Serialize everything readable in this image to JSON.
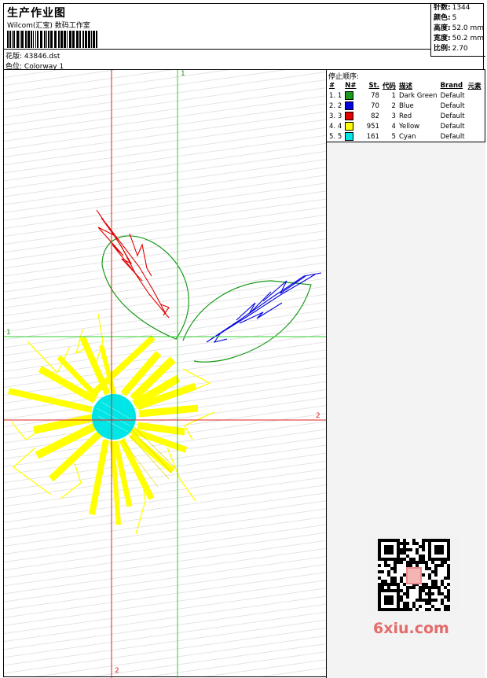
{
  "header": {
    "title": "生产作业图",
    "company": "Wilcom(汇宝) 数码工作室",
    "design_label": "花版:",
    "design_file": "43846.dst",
    "colorway_label": "色位:",
    "colorway": "Colorway 1"
  },
  "stats": {
    "stitches_label": "针数:",
    "stitches": "1344",
    "colors_label": "颜色:",
    "colors": "5",
    "height_label": "高度:",
    "height": "52.0 mm",
    "width_label": "宽度:",
    "width": "50.2 mm",
    "scale_label": "比例:",
    "scale": "2.70"
  },
  "legend": {
    "title": "停止顺序:",
    "columns": [
      "#",
      "N#",
      "St.",
      "代码",
      "描述",
      "Brand",
      "元素"
    ],
    "rows": [
      {
        "idx": "1.",
        "n": "1",
        "color": "#1a9a1a",
        "st": "78",
        "code": "1",
        "desc": "Dark Green",
        "brand": "Default"
      },
      {
        "idx": "2.",
        "n": "2",
        "color": "#0000e0",
        "st": "70",
        "code": "2",
        "desc": "Blue",
        "brand": "Default"
      },
      {
        "idx": "3.",
        "n": "3",
        "color": "#e00000",
        "st": "82",
        "code": "3",
        "desc": "Red",
        "brand": "Default"
      },
      {
        "idx": "4.",
        "n": "4",
        "color": "#ffff00",
        "st": "951",
        "code": "4",
        "desc": "Yellow",
        "brand": "Default"
      },
      {
        "idx": "5.",
        "n": "5",
        "color": "#00e6e6",
        "st": "161",
        "code": "5",
        "desc": "Cyan",
        "brand": "Default"
      }
    ]
  },
  "axes": {
    "green_v": "1",
    "green_h": "1",
    "red_h": "2",
    "red_v": "2"
  },
  "colors": {
    "guide_green": "#2fd02f",
    "guide_red": "#e02020"
  },
  "watermark": "6xiu.com"
}
